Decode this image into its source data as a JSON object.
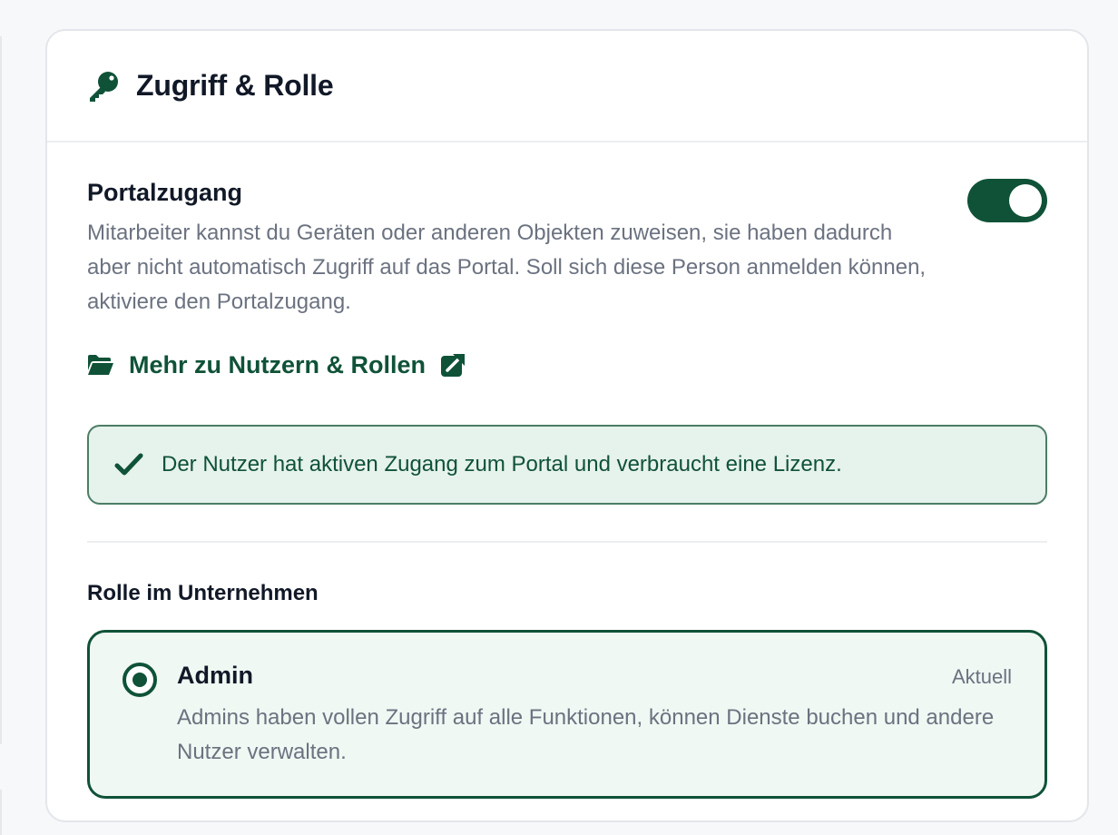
{
  "card": {
    "title": "Zugriff & Rolle",
    "title_icon": "key-icon"
  },
  "portal_access": {
    "title": "Portalzugang",
    "description": "Mitarbeiter kannst du Geräten oder anderen Objekten zuweisen, sie haben dadurch aber nicht automatisch Zugriff auf das Portal. Soll sich diese Person anmelden können, aktiviere den Portalzugang.",
    "toggle_on": true
  },
  "more_link": {
    "label": "Mehr zu Nutzern & Rollen",
    "icon": "folder-open-icon",
    "trailing_icon": "external-link-icon"
  },
  "info_box": {
    "icon": "check-icon",
    "text": "Der Nutzer hat aktiven Zugang zum Portal und verbraucht eine Lizenz."
  },
  "role_section": {
    "heading": "Rolle im Unternehmen",
    "options": [
      {
        "name": "Admin",
        "badge": "Aktuell",
        "description": "Admins haben vollen Zugriff auf alle Funktionen, können Dienste buchen und andere Nutzer verwalten.",
        "selected": true
      }
    ]
  },
  "colors": {
    "brand": "#0f5238",
    "info_bg": "#e6f2ec",
    "option_bg": "#f0f8f3",
    "muted_text": "#6b7280"
  }
}
